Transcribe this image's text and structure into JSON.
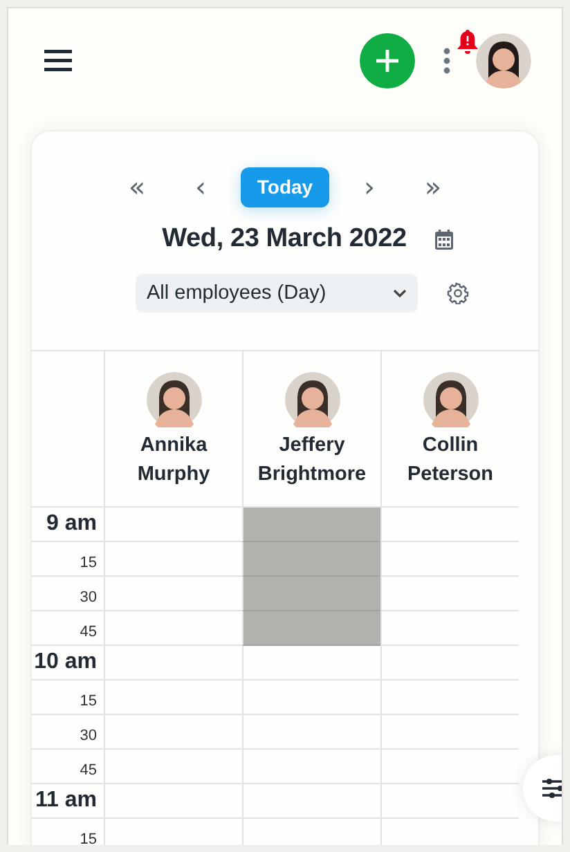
{
  "header": {
    "notification_alert": true
  },
  "navigation": {
    "first": "«",
    "previous": "‹",
    "today": "Today",
    "next": "›",
    "last": "»"
  },
  "date_title": "Wed, 23 March 2022",
  "view_select": {
    "value": "All employees (Day)"
  },
  "employees": [
    {
      "first_name": "Annika",
      "last_name": "Murphy"
    },
    {
      "first_name": "Jeffery",
      "last_name": "Brightmore"
    },
    {
      "first_name": "Collin",
      "last_name": "Peterson"
    }
  ],
  "slots": [
    {
      "kind": "hour",
      "label": "9 am",
      "blocked": [
        false,
        true,
        false
      ]
    },
    {
      "kind": "minute",
      "label": "15",
      "blocked": [
        false,
        true,
        false
      ]
    },
    {
      "kind": "minute",
      "label": "30",
      "blocked": [
        false,
        true,
        false
      ]
    },
    {
      "kind": "minute",
      "label": "45",
      "blocked": [
        false,
        true,
        false
      ]
    },
    {
      "kind": "hour",
      "label": "10 am",
      "blocked": [
        false,
        false,
        false
      ]
    },
    {
      "kind": "minute",
      "label": "15",
      "blocked": [
        false,
        false,
        false
      ]
    },
    {
      "kind": "minute",
      "label": "30",
      "blocked": [
        false,
        false,
        false
      ]
    },
    {
      "kind": "minute",
      "label": "45",
      "blocked": [
        false,
        false,
        false
      ]
    },
    {
      "kind": "hour",
      "label": "11 am",
      "blocked": [
        false,
        false,
        false
      ]
    },
    {
      "kind": "minute",
      "label": "15",
      "blocked": [
        false,
        false,
        false
      ]
    }
  ]
}
